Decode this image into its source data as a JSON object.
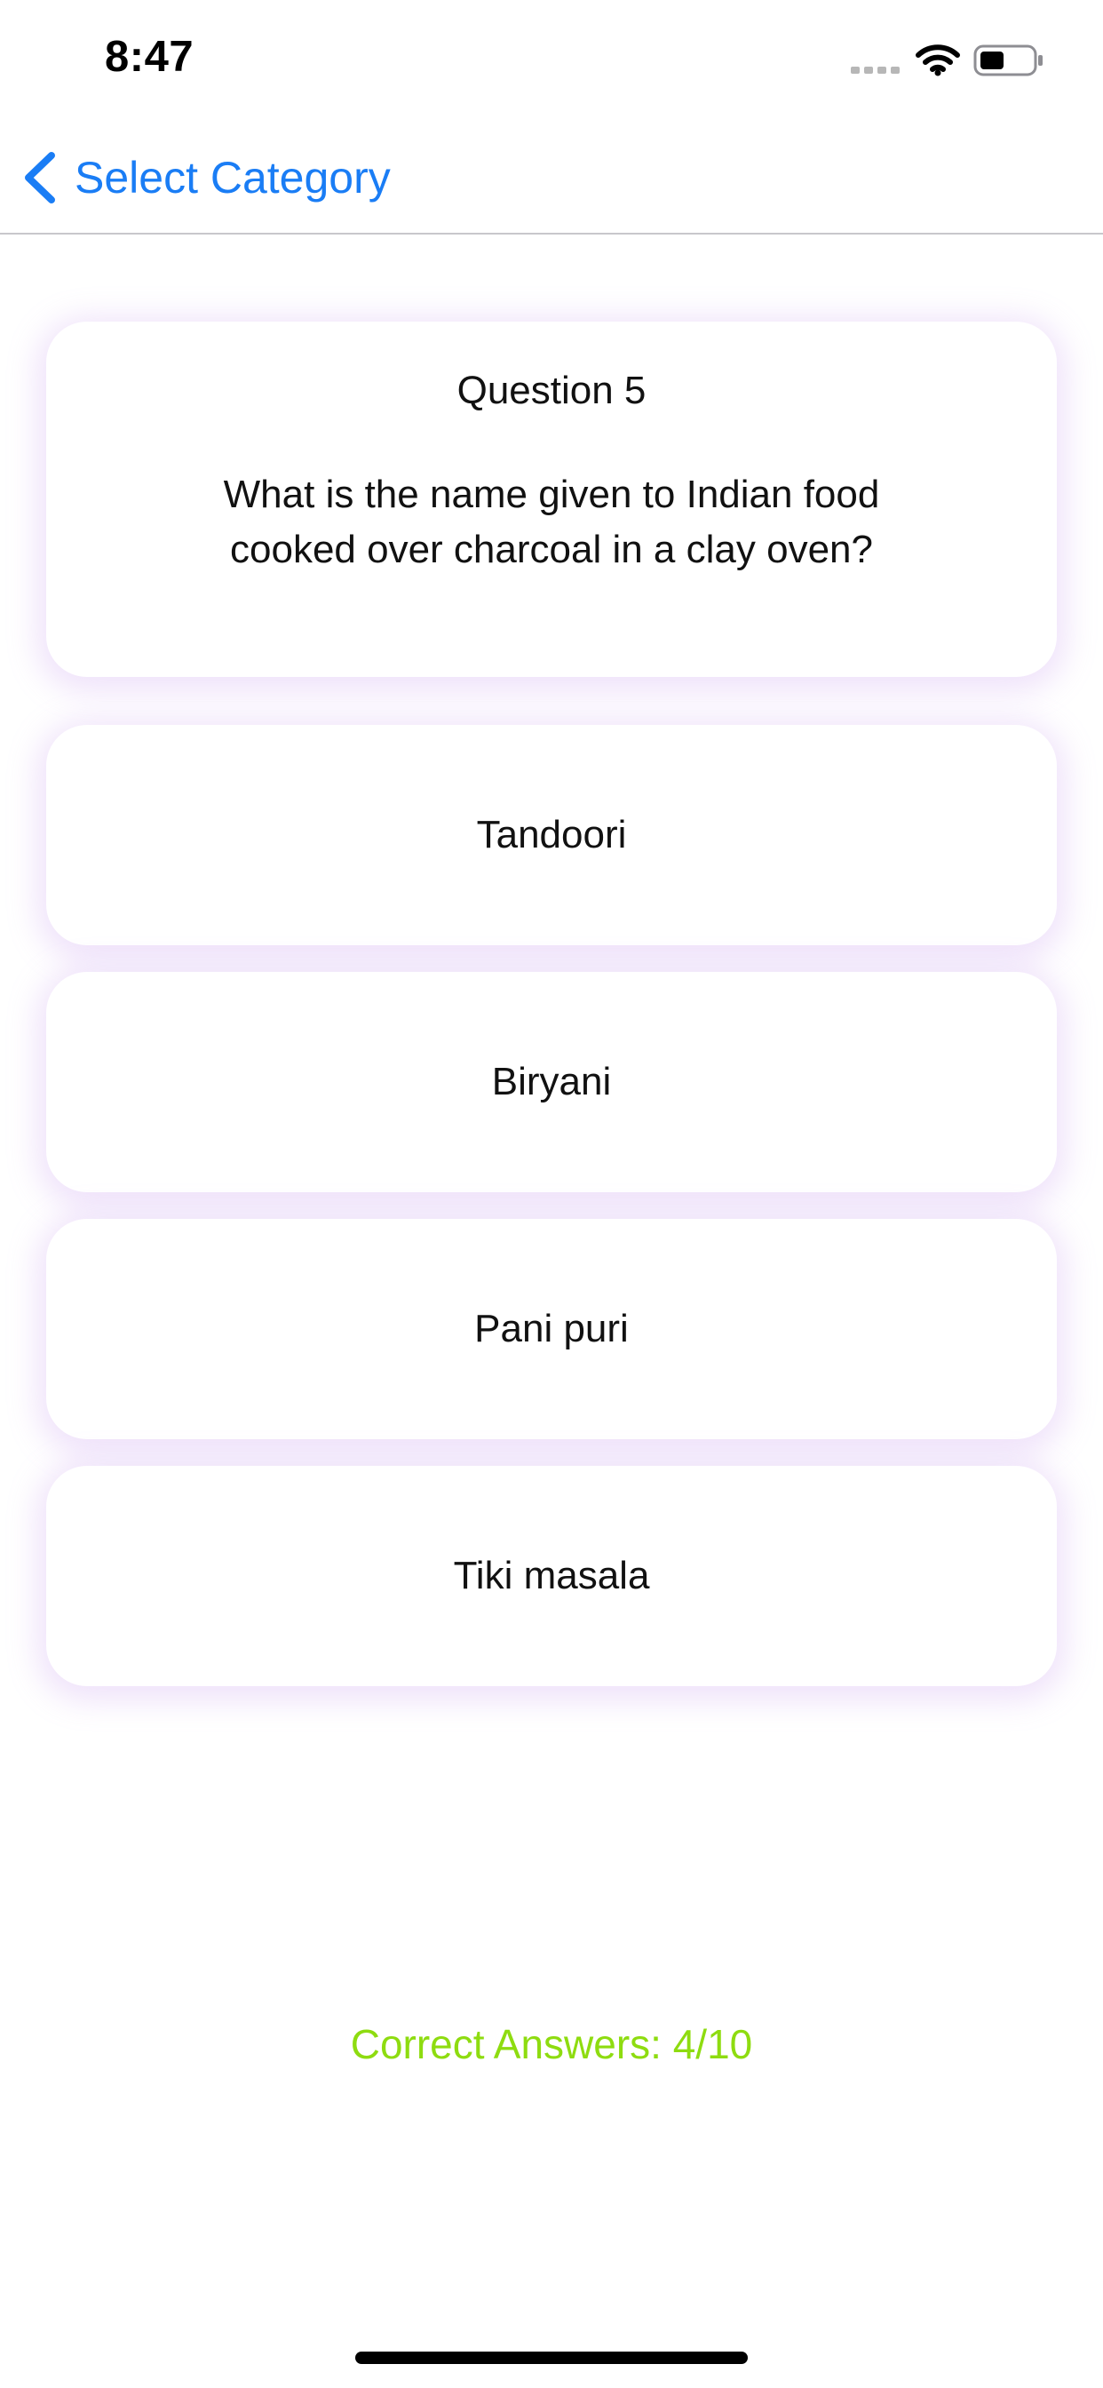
{
  "status_bar": {
    "time": "8:47",
    "icons": [
      "signal-dots-icon",
      "wifi-icon",
      "battery-icon"
    ]
  },
  "nav": {
    "back_icon": "chevron-left-icon",
    "back_label": "Select Category",
    "accent_color": "#1a7df5"
  },
  "question": {
    "number_label": "Question 5",
    "text": "What is the name given to Indian food cooked over charcoal in a clay oven?"
  },
  "answers": [
    {
      "label": "Tandoori"
    },
    {
      "label": "Biryani"
    },
    {
      "label": "Pani puri"
    },
    {
      "label": "Tiki masala"
    }
  ],
  "score": {
    "text": "Correct Answers: 4/10",
    "color": "#8edc10"
  }
}
